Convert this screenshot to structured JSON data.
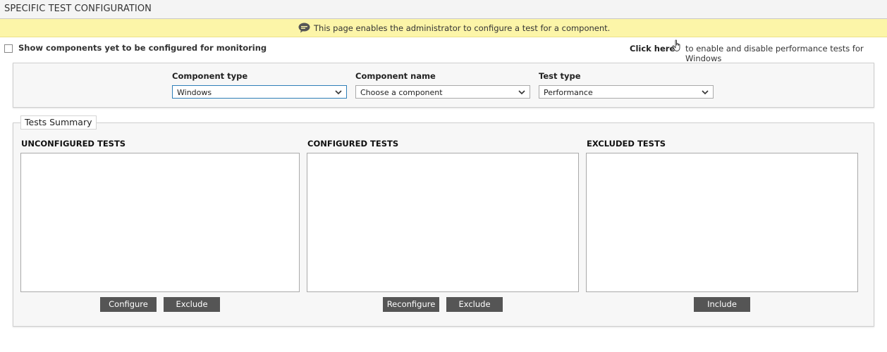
{
  "header": {
    "title": "SPECIFIC TEST CONFIGURATION"
  },
  "info": {
    "text": "This page enables the administrator to configure a test for a component.",
    "icon": "speech-bubble-icon"
  },
  "options": {
    "show_unconfigured_label": "Show components yet to be configured for monitoring",
    "show_unconfigured_checked": false,
    "click_here": "Click here",
    "click_here_rest": "to enable and disable performance tests for Windows"
  },
  "filters": {
    "component_type": {
      "label": "Component type",
      "value": "Windows"
    },
    "component_name": {
      "label": "Component name",
      "value": "Choose a component"
    },
    "test_type": {
      "label": "Test type",
      "value": "Performance"
    }
  },
  "summary": {
    "legend": "Tests Summary",
    "unconfigured": {
      "heading": "UNCONFIGURED TESTS",
      "items": [],
      "configure_label": "Configure",
      "exclude_label": "Exclude"
    },
    "configured": {
      "heading": "CONFIGURED TESTS",
      "items": [],
      "reconfigure_label": "Reconfigure",
      "exclude_label": "Exclude"
    },
    "excluded": {
      "heading": "EXCLUDED TESTS",
      "items": [],
      "include_label": "Include"
    }
  },
  "colors": {
    "info_bg": "#fcf5a8",
    "button_bg": "#555555",
    "active_select_border": "#2f7fb8"
  }
}
